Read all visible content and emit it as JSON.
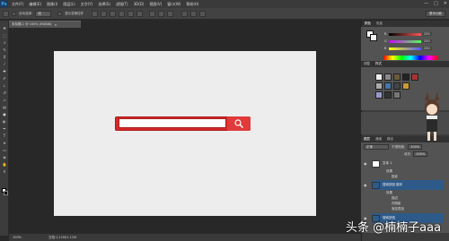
{
  "app": {
    "logo": "Ps"
  },
  "menu": [
    "文件(F)",
    "编辑(E)",
    "图像(I)",
    "图层(L)",
    "文字(Y)",
    "选择(S)",
    "滤镜(T)",
    "3D(D)",
    "视图(V)",
    "窗口(W)",
    "帮助(H)"
  ],
  "window_controls": {
    "minimize": "—",
    "maximize": "□",
    "close": "✕"
  },
  "options_bar": {
    "auto_select_label": "自动选择:",
    "auto_select_value": "组",
    "show_transform_label": "显示变换控件",
    "workspace_button": "基本功能"
  },
  "document_tab": {
    "title": "未标题-1 @ 100% (RGB/8)",
    "close": "×"
  },
  "status_bar": {
    "zoom": "100%",
    "doc_info": "文档:1.11M/1.11M"
  },
  "color_panel": {
    "tabs": [
      "颜色",
      "色板"
    ],
    "r": {
      "label": "R",
      "value": "255",
      "color": "#ff5050"
    },
    "g": {
      "label": "G",
      "value": "250",
      "color": "#50ff50"
    },
    "b": {
      "label": "B",
      "value": "250",
      "color": "#5050ff"
    }
  },
  "styles_panel": {
    "tabs": [
      "调整",
      "样式"
    ]
  },
  "layers_panel": {
    "tabs": [
      "图层",
      "通道",
      "路径"
    ],
    "blend_mode": "正常",
    "opacity_label": "不透明度:",
    "opacity_value": "100%",
    "fill_label": "填充:",
    "fill_value": "100%",
    "layers": [
      {
        "name": "文本 1",
        "selected": false,
        "effects_label": "效果",
        "effects": [
          "投影"
        ]
      },
      {
        "name": "搜索按钮 副本",
        "selected": true,
        "effects_label": "效果",
        "effects": [
          "描边",
          "内阴影",
          "渐变叠加"
        ]
      },
      {
        "name": "搜索按钮",
        "selected": true,
        "effects_label": "",
        "effects": []
      }
    ]
  },
  "search_bar": {
    "placeholder": ""
  },
  "watermark": "头条 @楠楠子aaa"
}
